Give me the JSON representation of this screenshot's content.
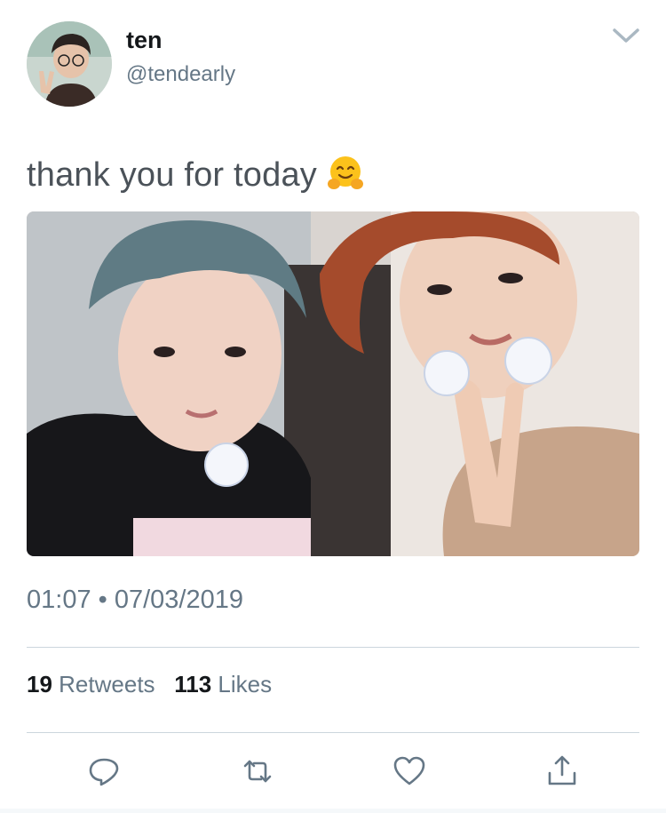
{
  "author": {
    "display_name": "ten",
    "handle": "@tendearly",
    "avatar_icon": "profile-avatar"
  },
  "tweet": {
    "text": "thank you for today",
    "emoji": "hugging-face-emoji",
    "media_description": "photo of two people holding round stickers",
    "timestamp": "01:07 • 07/03/2019"
  },
  "stats": {
    "retweets_count": "19",
    "retweets_label": "Retweets",
    "likes_count": "113",
    "likes_label": "Likes"
  },
  "actions": [
    "reply-icon",
    "retweet-icon",
    "like-icon",
    "share-icon"
  ],
  "colors": {
    "primary_text": "#14171a",
    "secondary_text": "#657786",
    "divider": "#ccd6dd"
  }
}
